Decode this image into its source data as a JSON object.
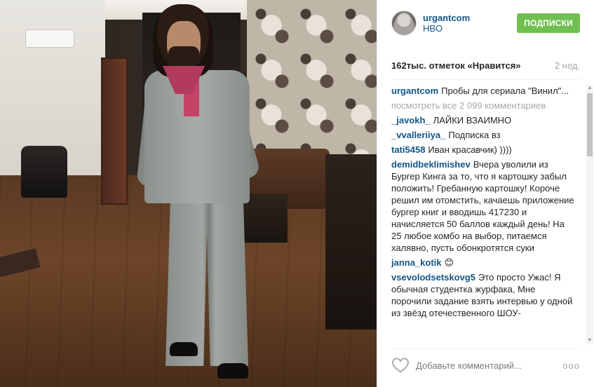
{
  "post": {
    "username": "urgantcom",
    "location": "HBO",
    "follow_label": "ПОДПИСКИ",
    "likes": "162тыс. отметок «Нравится»",
    "time": "2 нед.",
    "caption": {
      "user": "urgantcom",
      "text": "Пробы для сериала \"Винил\"..."
    },
    "view_all": "посмотреть все 2 099 комментариев",
    "comments": [
      {
        "user": "_javokh_",
        "text": "ЛАЙКИ ВЗАИМНО"
      },
      {
        "user": "_vvalleriiya_",
        "text": "Подписка вз"
      },
      {
        "user": "tati5458",
        "text": "Иван красавчик) ))))"
      },
      {
        "user": "demidbeklimishev",
        "text": "Вчера уволили из Бургер Кинга за то, что я картошку забыл положить! Гребанную картошку! Короче решил им отомстить, качаешь приложение бургер книг и вводишь 417230 и начисляется 50 баллов каждый день! На 25 любое комбо на выбор, питаемся халявно, пусть обонкротятся суки"
      },
      {
        "user": "janna_kotik",
        "text": "😊"
      },
      {
        "user": "vsevolodsetskovg5",
        "text": "Это просто Ужас! Я обычная студентка журфака, Мне порочили задание взять интервью у одной из звёзд отечественного ШОУ-"
      }
    ],
    "add_comment_placeholder": "Добавьте комментарий...",
    "more_label": "ooo"
  },
  "icons": {
    "heart": "heart-icon",
    "more": "more-options-icon"
  },
  "colors": {
    "link_blue": "#125688",
    "follow_green": "#70c050",
    "muted": "#a5a7aa"
  }
}
